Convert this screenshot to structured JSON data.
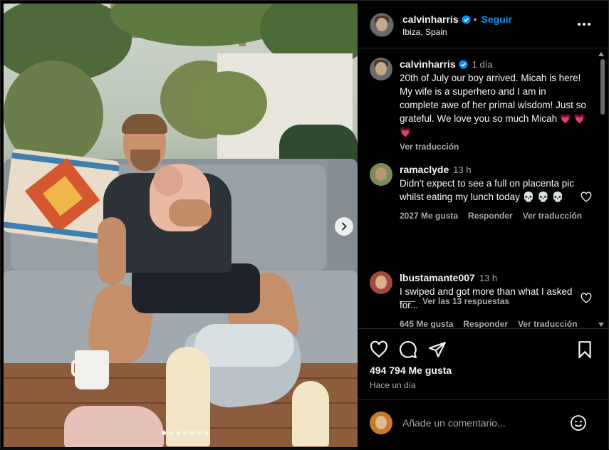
{
  "post_header": {
    "username": "calvinharris",
    "separator": "•",
    "follow_label": "Seguir",
    "location": "Ibiza, Spain"
  },
  "caption": {
    "username": "calvinharris",
    "time": "1 día",
    "text": "20th of July our boy arrived. Micah is here! My wife is a superhero and I am in complete awe of her primal wisdom! Just so grateful. We love you so much Micah",
    "emojis": "💗 💗 💗",
    "translate_label": "Ver traducción"
  },
  "comments": [
    {
      "username": "ramaclyde",
      "time": "13 h",
      "text": "Didn't expect to see a full on placenta pic whilst eating my lunch today",
      "emojis": "💀 💀 💀",
      "likes": "2027 Me gusta",
      "reply_label": "Responder",
      "translate_label": "Ver traducción",
      "view_replies": "Ver las 13 respuestas"
    },
    {
      "username": "lbustamante007",
      "time": "13 h",
      "text": "I swiped and got more than what I asked for...",
      "likes": "645 Me gusta",
      "reply_label": "Responder",
      "translate_label": "Ver traducción"
    }
  ],
  "likes_count": "494 794 Me gusta",
  "posted_ago": "Hace un día",
  "add_comment_placeholder": "Añade un comentario...",
  "carousel": {
    "total": 7,
    "active_index": 0
  },
  "colors": {
    "accent": "#0095f6",
    "background": "#000000",
    "muted": "#a8a8a8"
  },
  "icons": [
    "verified-badge-icon",
    "more-options-icon",
    "heart-icon",
    "comment-icon",
    "share-icon",
    "bookmark-icon",
    "emoji-icon",
    "next-arrow-icon"
  ]
}
